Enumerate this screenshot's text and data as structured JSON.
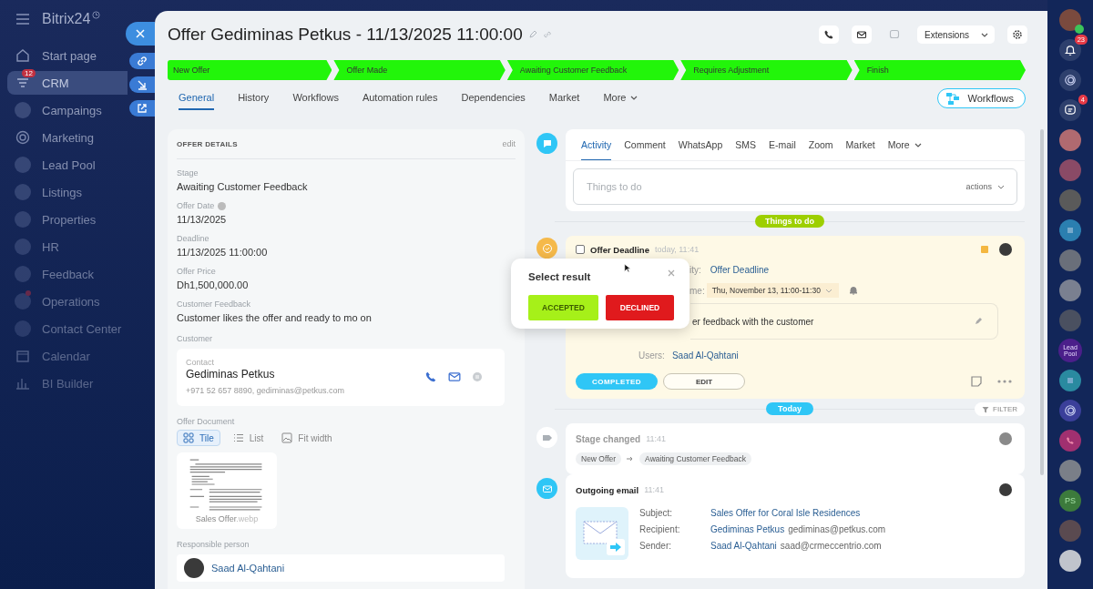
{
  "sidebar": {
    "logo": "Bitrix24",
    "items": [
      {
        "label": "Start page",
        "kind": "home",
        "selected": false
      },
      {
        "label": "CRM",
        "kind": "filter",
        "selected": true,
        "badge": "12"
      },
      {
        "label": "Campaings",
        "kind": "circle",
        "selected": false
      },
      {
        "label": "Marketing",
        "kind": "target",
        "selected": false
      },
      {
        "label": "Lead Pool",
        "kind": "circle",
        "selected": false
      },
      {
        "label": "Listings",
        "kind": "circle",
        "selected": false
      },
      {
        "label": "Properties",
        "kind": "circle",
        "selected": false
      },
      {
        "label": "HR",
        "kind": "circle",
        "selected": false
      },
      {
        "label": "Feedback",
        "kind": "circle",
        "selected": false
      },
      {
        "label": "Operations",
        "kind": "circle",
        "selected": false,
        "dot": true
      },
      {
        "label": "Contact Center",
        "kind": "circle",
        "selected": false
      },
      {
        "label": "Calendar",
        "kind": "calendar",
        "selected": false
      },
      {
        "label": "BI Builder",
        "kind": "chart",
        "selected": false
      }
    ]
  },
  "header": {
    "title": "Offer Gediminas Petkus - 11/13/2025 11:00:00",
    "extensions": "Extensions"
  },
  "stages": [
    {
      "label": "New Offer",
      "passed": true
    },
    {
      "label": "Offer Made",
      "passed": true
    },
    {
      "label": "Awaiting Customer Feedback",
      "passed": true
    },
    {
      "label": "Requires Adjustment",
      "passed": true
    },
    {
      "label": "Finish",
      "passed": true
    }
  ],
  "tabs": [
    {
      "label": "General",
      "selected": true,
      "kind": "tab"
    },
    {
      "label": "History",
      "selected": false,
      "kind": "tab"
    },
    {
      "label": "Workflows",
      "selected": false,
      "kind": "tab"
    },
    {
      "label": "Automation rules",
      "selected": false,
      "kind": "tab"
    },
    {
      "label": "Dependencies",
      "selected": false,
      "kind": "tab"
    },
    {
      "label": "Market",
      "selected": false,
      "kind": "tab"
    },
    {
      "label": "More",
      "selected": false,
      "kind": "dropdown"
    }
  ],
  "workflows_button": "Workflows",
  "details": {
    "title": "OFFER DETAILS",
    "edit": "edit",
    "fields": [
      {
        "label": "Stage",
        "value": "Awaiting Customer Feedback",
        "help": false
      },
      {
        "label": "Offer Date",
        "value": "11/13/2025",
        "help": true
      },
      {
        "label": "Deadline",
        "value": "11/13/2025 11:00:00",
        "help": false
      },
      {
        "label": "Offer Price",
        "value": "Dh1,500,000.00",
        "help": false
      },
      {
        "label": "Customer Feedback",
        "value": "Customer likes the offer and ready to mo on",
        "help": false
      }
    ],
    "customer": {
      "label": "Customer",
      "contact_label": "Contact",
      "name": "Gediminas Petkus",
      "info": "+971 52 657 8890, gediminas@petkus.com"
    },
    "document": {
      "label": "Offer Document",
      "views": [
        {
          "label": "Tile",
          "selected": true,
          "kind": "tile"
        },
        {
          "label": "List",
          "selected": false,
          "kind": "list"
        },
        {
          "label": "Fit width",
          "selected": false,
          "kind": "fit"
        }
      ],
      "file_name": "Sales Offer",
      "file_ext": ".webp"
    },
    "responsible": {
      "label": "Responsible person",
      "name": "Saad Al-Qahtani"
    }
  },
  "composer": {
    "tabs": [
      {
        "label": "Activity",
        "selected": true,
        "kind": "tab"
      },
      {
        "label": "Comment",
        "selected": false,
        "kind": "tab"
      },
      {
        "label": "WhatsApp",
        "selected": false,
        "kind": "tab"
      },
      {
        "label": "SMS",
        "selected": false,
        "kind": "tab"
      },
      {
        "label": "E-mail",
        "selected": false,
        "kind": "tab"
      },
      {
        "label": "Zoom",
        "selected": false,
        "kind": "tab"
      },
      {
        "label": "Market",
        "selected": false,
        "kind": "tab"
      },
      {
        "label": "More",
        "selected": false,
        "kind": "dropdown"
      }
    ],
    "placeholder": "Things to do",
    "actions": "actions"
  },
  "todo_divider": "Things to do",
  "todo": {
    "checked": false,
    "title": "Offer Deadline",
    "time": "today, 11:41",
    "activity_label": "ity:",
    "activity": "Offer Deadline",
    "time_label": "me:",
    "time_value": "Thu, November 13, 11:00-11:30",
    "description": "er feedback with the customer",
    "users_label": "Users:",
    "user": "Saad Al-Qahtani",
    "complete": "COMPLETED",
    "edit": "EDIT"
  },
  "popup": {
    "title": "Select result",
    "buttons": [
      {
        "label": "ACCEPTED",
        "kind": "accept"
      },
      {
        "label": "DECLINED",
        "kind": "decline"
      }
    ]
  },
  "today_divider": "Today",
  "filter": "FILTER",
  "stage_change": {
    "title": "Stage changed",
    "time": "11:41",
    "from": "New Offer",
    "to": "Awaiting Customer Feedback"
  },
  "email": {
    "title": "Outgoing email",
    "time": "11:41",
    "rows": [
      {
        "label": "Subject:",
        "value": "Sales Offer for Coral Isle Residences"
      },
      {
        "label": "Recipient:",
        "value": "Gediminas Petkus",
        "extra": "gediminas@petkus.com"
      },
      {
        "label": "Sender:",
        "value": "Saad Al-Qahtani",
        "extra": "saad@crmeccentrio.com"
      }
    ]
  },
  "rail": [
    {
      "kind": "avatar",
      "color": "#7a4a3e",
      "online": true
    },
    {
      "kind": "bell",
      "badge": "23"
    },
    {
      "kind": "copilot"
    },
    {
      "kind": "chat",
      "badge": "4"
    },
    {
      "kind": "avatar",
      "color": "#b06a70"
    },
    {
      "kind": "avatar",
      "color": "#8a4a66"
    },
    {
      "kind": "avatar",
      "color": "#5a5a5a"
    },
    {
      "kind": "app",
      "color": "#2b7fb0"
    },
    {
      "kind": "avatar",
      "color": "#6a6f7a"
    },
    {
      "kind": "avatar",
      "color": "#7a8090"
    },
    {
      "kind": "avatar",
      "color": "#4a5060"
    },
    {
      "kind": "label",
      "color": "#4b1f8a",
      "text": "Lead Pool"
    },
    {
      "kind": "app",
      "color": "#2a8aa0"
    },
    {
      "kind": "copilot",
      "color": "#3b3f9a"
    },
    {
      "kind": "phone",
      "color": "#a03070"
    },
    {
      "kind": "avatar",
      "color": "#7a7f88"
    },
    {
      "kind": "initials",
      "color": "#3c7a3c",
      "text": "PS"
    },
    {
      "kind": "avatar",
      "color": "#5a4a50"
    },
    {
      "kind": "avatar",
      "color": "#c0c4cc"
    }
  ]
}
